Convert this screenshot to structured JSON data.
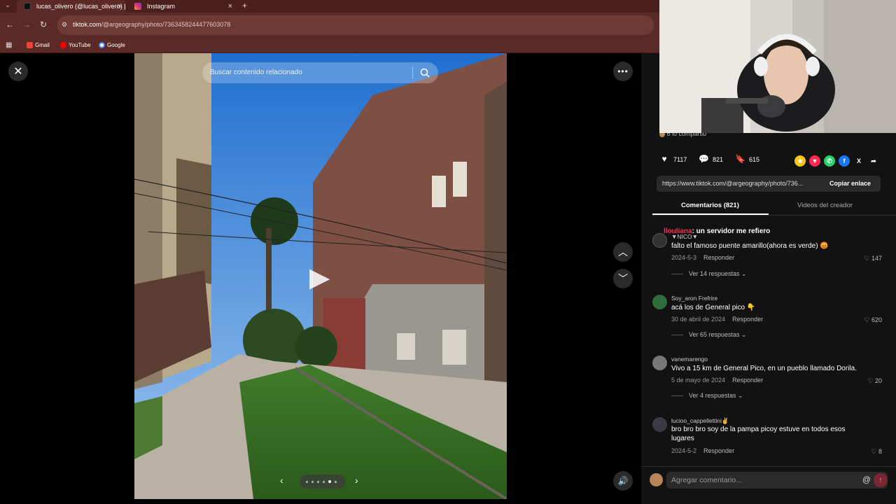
{
  "browser": {
    "tabs": [
      {
        "title": "lucas_olivero (@lucas_olivero) |",
        "active": true
      },
      {
        "title": "Instagram",
        "active": false
      }
    ],
    "url_host": "tiktok.com",
    "url_path": "/@argeography/photo/7363458244477603078",
    "bookmarks": [
      "Gmail",
      "YouTube",
      "Google"
    ]
  },
  "player": {
    "search_placeholder": "Buscar contenido relacionado",
    "play_symbol": "▶"
  },
  "panel": {
    "shared_text": "6 lo compartió",
    "stats": {
      "likes": "7117",
      "comments": "821",
      "saves": "615"
    },
    "share_link": "https://www.tiktok.com/@argeography/photo/736...",
    "copy_label": "Copiar enlace",
    "tabs": [
      "Comentarios (821)",
      "Videos del creador"
    ],
    "reply_label": "Responder",
    "comments": [
      {
        "username": "▼NICO▼",
        "header_user": "llouliana",
        "header_text": ": un servidor me refiero",
        "text": "falto el famoso puente amarillo(ahora es verde) 😡",
        "date": "2024-5-3",
        "likes": "147",
        "replies": "Ver 14 respuestas"
      },
      {
        "username": "Soy_aron Frefrire",
        "text": "acá los de General pico 👇",
        "date": "30 de abril de 2024",
        "likes": "620",
        "replies": "Ver 65 respuestas"
      },
      {
        "username": "vanemarengo",
        "text": "Vivo a 15 km de General Pico, en un pueblo llamado Dorila.",
        "date": "5 de mayo de 2024",
        "likes": "20",
        "replies": "Ver 4 respuestas"
      },
      {
        "username": "lucioo_cappellettini✌",
        "text": "bro bro bro soy de la pampa picoy estuve en todos esos lugares",
        "date": "2024-5-2",
        "likes": "8"
      }
    ],
    "comment_placeholder": "Agregar comentario..."
  },
  "colors": {
    "browser_frame": "#5b2a27",
    "panel_bg": "#121212",
    "accent_red": "#fe2c55"
  }
}
